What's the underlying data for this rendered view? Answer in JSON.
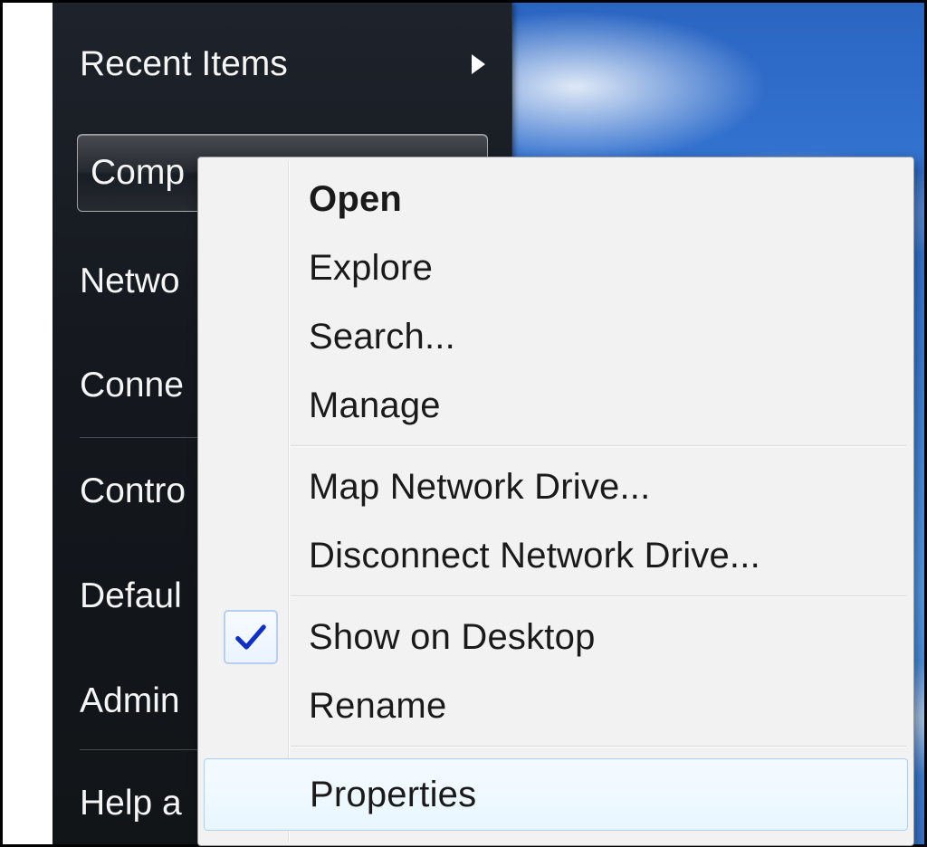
{
  "start_panel": {
    "items": [
      {
        "label": "Recent Items",
        "has_submenu": true
      },
      {
        "label": "Comp",
        "selected": true
      },
      {
        "label": "Netwo"
      },
      {
        "label": "Conne"
      },
      {
        "label": "Contro"
      },
      {
        "label": "Defaul"
      },
      {
        "label": "Admin"
      },
      {
        "label": "Help a"
      }
    ]
  },
  "context_menu": {
    "items": [
      {
        "label": "Open",
        "bold": true
      },
      {
        "label": "Explore"
      },
      {
        "label": "Search..."
      },
      {
        "label": "Manage"
      },
      {
        "label": "Map Network Drive..."
      },
      {
        "label": "Disconnect Network Drive..."
      },
      {
        "label": "Show on Desktop",
        "checked": true
      },
      {
        "label": "Rename"
      },
      {
        "label": "Properties",
        "hover": true
      }
    ]
  }
}
